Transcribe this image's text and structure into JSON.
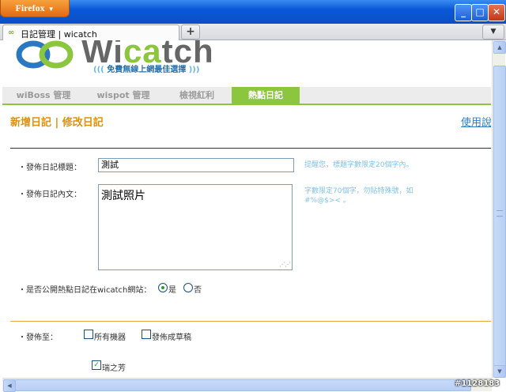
{
  "browser": {
    "menu_button": "Firefox",
    "tab_title": "日記管理 | wicatch",
    "new_tab": "+",
    "window_min": "_",
    "window_max": "□",
    "window_close": "✕"
  },
  "logo": {
    "text_prefix": "Wi",
    "text_highlight": "ca",
    "text_suffix": "tch",
    "tagline": "免費無線上網最佳選擇"
  },
  "nav": {
    "items": [
      {
        "label": "wiBoss 管理",
        "active": false
      },
      {
        "label": "wispot 管理",
        "active": false
      },
      {
        "label": "檢視紅利",
        "active": false
      },
      {
        "label": "熱點日記",
        "active": true
      }
    ]
  },
  "page": {
    "heading": "新增日記 | 修改日記",
    "help_link": "使用說"
  },
  "form": {
    "title_label": "・發佈日記標題：",
    "title_value": "測試",
    "title_hint": "提醒您，標題字數限定20個字內。",
    "body_label": "・發佈日記內文：",
    "body_value": "測試照片",
    "body_hint": "字數限定70個字，勿貼特殊號，如#%@$>< 。",
    "public_label": "・是否公開熱點日記在wicatch網站：",
    "public_yes": "是",
    "public_no": "否",
    "public_selected": "是",
    "publish_label": "・發佈至：",
    "opt_all_devices": "所有機器",
    "opt_draft": "發佈成草稿",
    "opt_device": "瑞之芳"
  },
  "watermark": "#1128183",
  "colors": {
    "brand_green": "#8cc63e",
    "heading_orange": "#e1900a",
    "link_blue": "#2e7fc6",
    "hint_blue": "#7fc3ea"
  }
}
